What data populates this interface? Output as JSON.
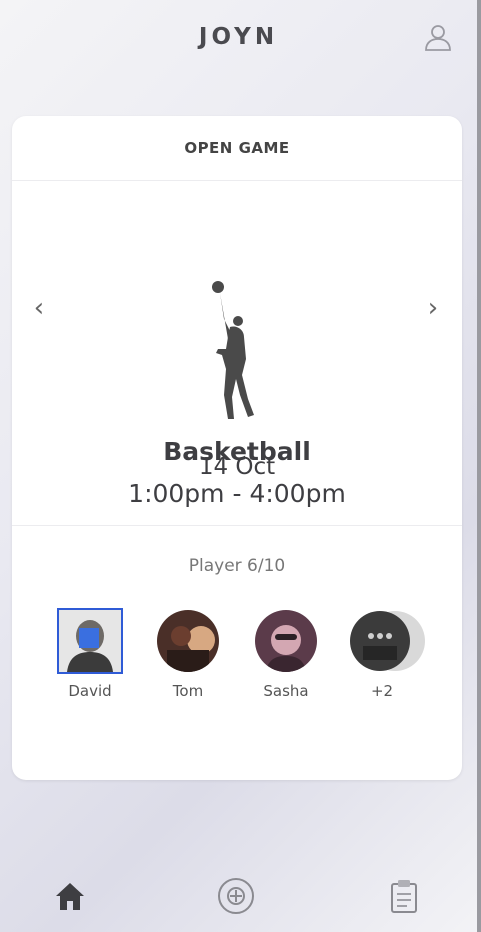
{
  "app": {
    "logo": "JOYN"
  },
  "card": {
    "header": "OPEN GAME",
    "game": {
      "sport": "Basketball",
      "time": "1:00pm - 4:00pm",
      "date": "14 Oct"
    },
    "players": {
      "count_label": "Player 6/10",
      "list": [
        {
          "name": "David"
        },
        {
          "name": "Tom"
        },
        {
          "name": "Sasha"
        },
        {
          "name": "+2"
        }
      ]
    }
  },
  "nav": {
    "left_arrow": "‹",
    "right_arrow": "›"
  },
  "icons": {
    "profile": "user-icon",
    "home": "home-icon",
    "add": "add-circle-icon",
    "clipboard": "clipboard-icon",
    "silhouette": "basketball-player-icon"
  },
  "colors": {
    "selection_outline": "#2f5bd6"
  }
}
